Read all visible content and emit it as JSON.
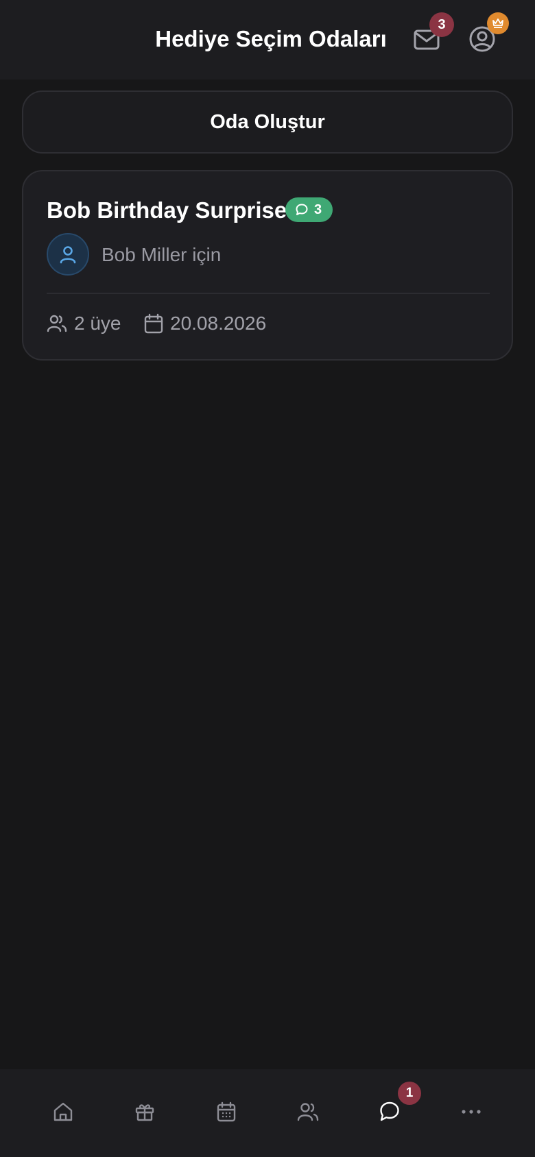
{
  "header": {
    "title": "Hediye Seçim Odaları",
    "mail_badge_count": "3",
    "mail_icon": "mail-icon",
    "profile_icon": "user-circle-icon",
    "premium_icon": "crown-icon"
  },
  "actions": {
    "create_room_label": "Oda Oluştur"
  },
  "rooms": [
    {
      "title": "Bob Birthday Surprise",
      "chat_count": "3",
      "recipient_text": "Bob Miller için",
      "members_text": "2 üye",
      "date_text": "20.08.2026"
    }
  ],
  "bottom_nav": {
    "items": [
      "home-icon",
      "gift-icon",
      "calendar-icon",
      "users-icon",
      "chat-icon",
      "more-icon"
    ],
    "active": "chat-icon",
    "chat_badge_count": "1"
  },
  "colors": {
    "background": "#171718",
    "surface": "#1e1e22",
    "badge_red": "#8b3443",
    "chat_pill_green": "#3fa874",
    "crown_orange": "#e08a2e",
    "avatar_blue": "#5aa7e6"
  }
}
